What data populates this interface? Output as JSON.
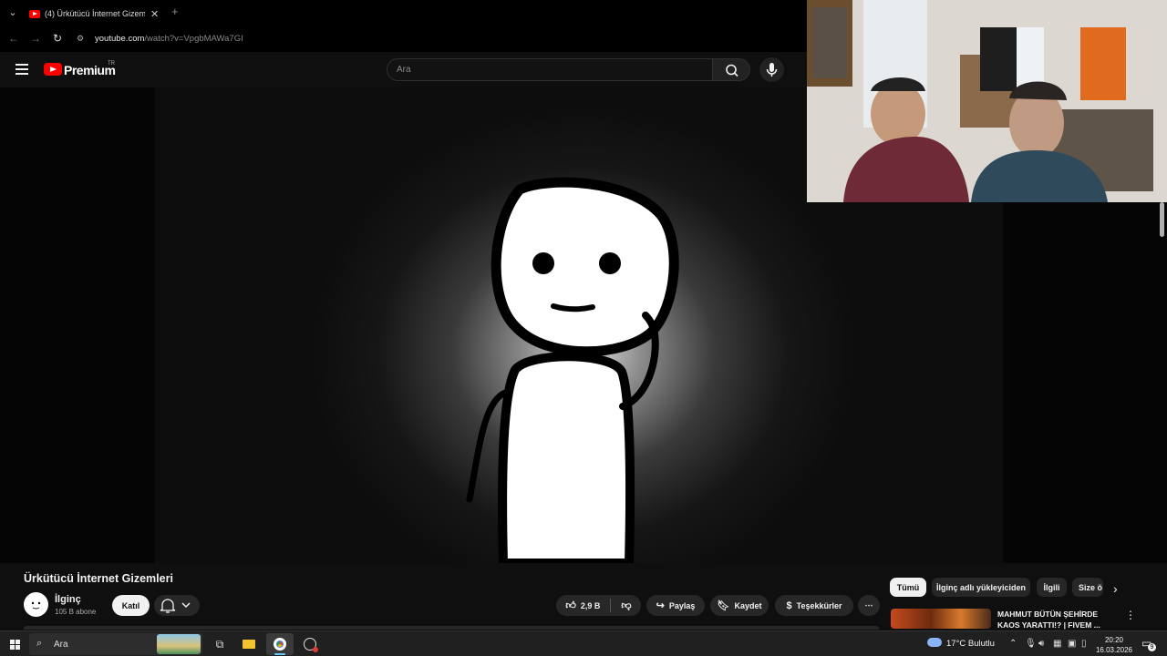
{
  "browser": {
    "tab_title": "(4) Ürkütücü İnternet Gizemleri",
    "close_glyph": "✕",
    "newtab_glyph": "+",
    "url_host": "youtube.com",
    "url_path": "/watch?v=VpgbMAWa7GI"
  },
  "youtube": {
    "logo_text": "Premium",
    "region": "TR",
    "search_placeholder": "Ara"
  },
  "video": {
    "title": "Ürkütücü İnternet Gizemleri",
    "channel": "İlginç",
    "subscribers": "105 B abone",
    "join_label": "Katıl",
    "likes": "2,9 B",
    "share_label": "Paylaş",
    "save_label": "Kaydet",
    "thanks_label": "Teşekkürler"
  },
  "chips": [
    "Tümü",
    "İlginç adlı yükleyiciden",
    "İlgili",
    "Size ö"
  ],
  "recommendation": {
    "title": "MAHMUT BÜTÜN ŞEHİRDE KAOS YARATTI!? | FIVEM ..."
  },
  "taskbar": {
    "search_text": "Ara",
    "weather": "17°C  Bulutlu",
    "time": "20:20",
    "date": "16.03.2026",
    "notifications": "9"
  },
  "colors": {
    "accent_red": "#ff0000",
    "background": "#0f0f0f",
    "pill": "#272727"
  }
}
